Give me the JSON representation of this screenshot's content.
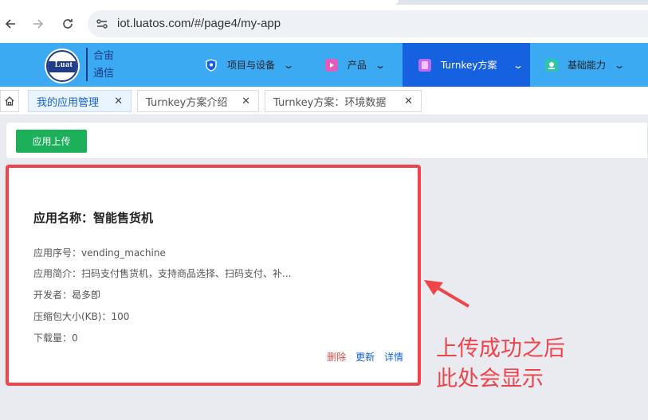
{
  "browser": {
    "url": "iot.luatos.com/#/page4/my-app"
  },
  "header": {
    "logo_text": "Luat",
    "company_line1": "合宙",
    "company_line2": "通信",
    "menu": [
      {
        "label": "项目与设备",
        "icon": "shield-icon",
        "color": "#ffffff"
      },
      {
        "label": "产品",
        "icon": "product-icon",
        "color": "#e35cbd"
      },
      {
        "label": "Turnkey方案",
        "icon": "turnkey-icon",
        "color": "#c066ff"
      },
      {
        "label": "基础能力",
        "icon": "capability-icon",
        "color": "#2dc7a8"
      }
    ],
    "active_menu_color": "#1661e0",
    "bar_color": "#3baaf2"
  },
  "tabs": [
    {
      "label": "我的应用管理",
      "active": true
    },
    {
      "label": "Turnkey方案介绍",
      "active": false
    },
    {
      "label": "Turnkey方案：环境数据",
      "active": false
    }
  ],
  "toolbar": {
    "upload_label": "应用上传"
  },
  "app_card": {
    "title": "应用名称：智能售货机",
    "serial": "应用序号：vending_machine",
    "description": "应用简介：扫码支付售货机，支持商品选择、扫码支付、补...",
    "developer": "开发者：曷多卽",
    "size": "压缩包大小(KB)：100",
    "downloads": "下载量：0",
    "actions": {
      "delete": "删除",
      "update": "更新",
      "detail": "详情"
    }
  },
  "annotation": {
    "line1": "上传成功之后",
    "line2": "此处会显示",
    "color": "#f0444b"
  }
}
